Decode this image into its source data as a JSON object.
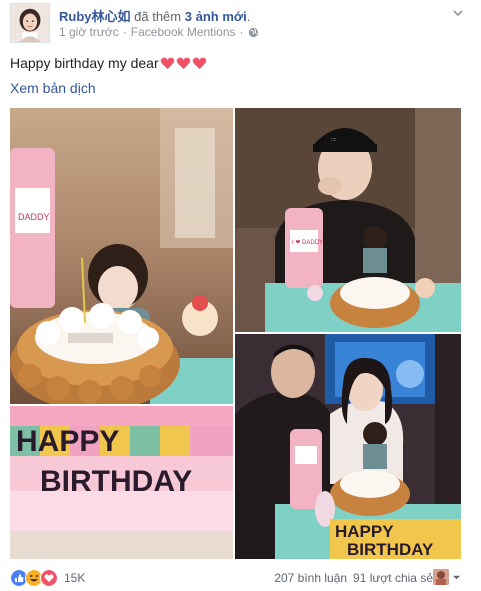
{
  "post": {
    "author_name": "Ruby林心如",
    "action_prefix": "đã thêm",
    "action_bold": "3 ảnh mới",
    "action_suffix": ".",
    "time": "1 giờ trước",
    "separator": "·",
    "source": "Facebook Mentions",
    "message": "Happy birthday my dear",
    "heart_count": 3,
    "translate_link": "Xem bản dịch"
  },
  "photos": {
    "photo1_cake_text": "DADDY",
    "photo2_banner": [
      "HAPPY",
      "BIRTHDAY"
    ],
    "photo3_cake_text": "I ❤ DADDY",
    "photo4_banner": [
      "HAPPY",
      "BIRTHDAY"
    ]
  },
  "footer": {
    "reaction_count": "15K",
    "comments": "207 bình luận",
    "shares": "91 lượt chia sẻ"
  },
  "colors": {
    "link": "#365899",
    "meta": "#90949c",
    "heart": "#f25268",
    "like": "#4a7ff5",
    "haha": "#f7b125"
  },
  "icons": [
    "globe-icon",
    "chevron-down-icon",
    "heart-emoji-icon",
    "like-reaction-icon",
    "haha-reaction-icon",
    "love-reaction-icon",
    "caret-down-icon"
  ]
}
